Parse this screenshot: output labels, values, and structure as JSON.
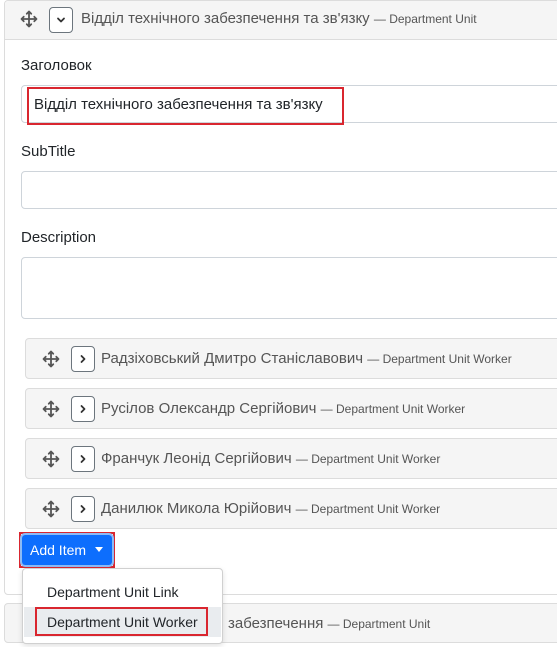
{
  "unit": {
    "title": "Відділ технічного забезпечення та зв'язку",
    "type": "— Department Unit",
    "fields": {
      "title_label": "Заголовок",
      "title_value": "Відділ технічного забезпечення та зв'язку",
      "subtitle_label": "SubTitle",
      "subtitle_value": "",
      "description_label": "Description",
      "description_value": ""
    },
    "workers": [
      {
        "name": "Радзіховський Дмитро Станіславович",
        "type": "— Department Unit Worker"
      },
      {
        "name": "Русілов Олександр Сергійович",
        "type": "— Department Unit Worker"
      },
      {
        "name": "Франчук Леонід Сергійович",
        "type": "— Department Unit Worker"
      },
      {
        "name": "Данилюк Микола Юрійович",
        "type": "— Department Unit Worker"
      }
    ],
    "add_item_label": "Add Item",
    "add_item_menu": [
      {
        "label": "Department Unit Link"
      },
      {
        "label": "Department Unit Worker"
      }
    ]
  },
  "next_unit": {
    "title_visible": "забезпечення",
    "type": "— Department Unit"
  },
  "colors": {
    "highlight": "#d9262f",
    "primary": "#0d6efd",
    "header_bg": "#f5f5f5"
  },
  "icons": {
    "drag": "drag-move-icon",
    "expand": "chevron-right-icon",
    "collapse": "chevron-down-icon",
    "dropdown": "caret-down-icon"
  }
}
